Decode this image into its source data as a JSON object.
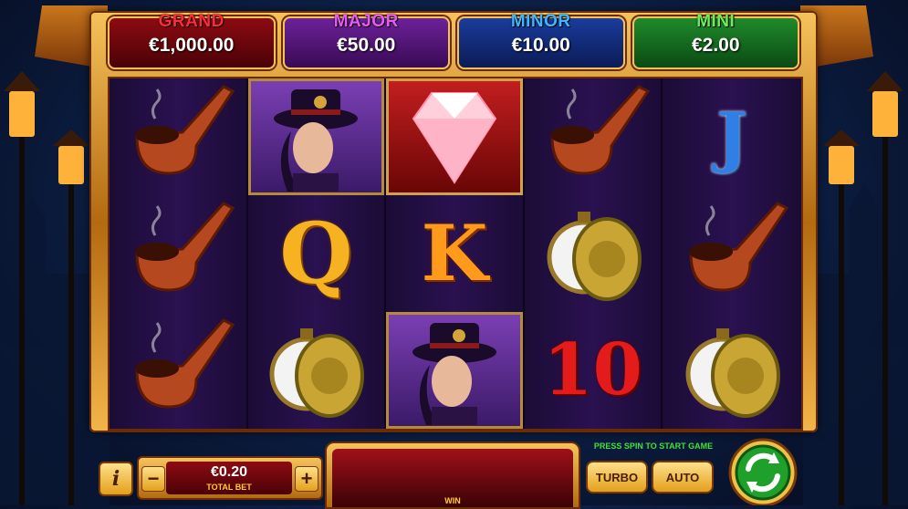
{
  "jackpots": [
    {
      "title": "GRAND",
      "value": "€1,000.00"
    },
    {
      "title": "MAJOR",
      "value": "€50.00"
    },
    {
      "title": "MINOR",
      "value": "€10.00"
    },
    {
      "title": "MINI",
      "value": "€2.00"
    }
  ],
  "reels": [
    [
      "pipe-icon",
      "pipe-icon",
      "pipe-icon"
    ],
    [
      "lady-icon",
      "Q",
      "pocket-watch-icon"
    ],
    [
      "diamond-icon",
      "K",
      "lady-icon"
    ],
    [
      "pipe-icon",
      "pocket-watch-icon",
      "10"
    ],
    [
      "J",
      "pipe-icon",
      "pocket-watch-icon"
    ]
  ],
  "letters": {
    "q": "Q",
    "k": "K",
    "j": "J",
    "ten": "10"
  },
  "controls": {
    "info_label": "i",
    "minus_label": "−",
    "plus_label": "+",
    "bet_value": "€0.20",
    "bet_label": "TOTAL BET",
    "win_label": "WIN",
    "hint": "PRESS SPIN TO START GAME",
    "turbo_label": "TURBO",
    "auto_label": "AUTO"
  },
  "colors": {
    "grand": "#ff2a3a",
    "major": "#e75cf0",
    "minor": "#3fb7ff",
    "mini": "#6cf05a",
    "frame_gold": "#f6c35b",
    "spin_green": "#1fa02a"
  }
}
